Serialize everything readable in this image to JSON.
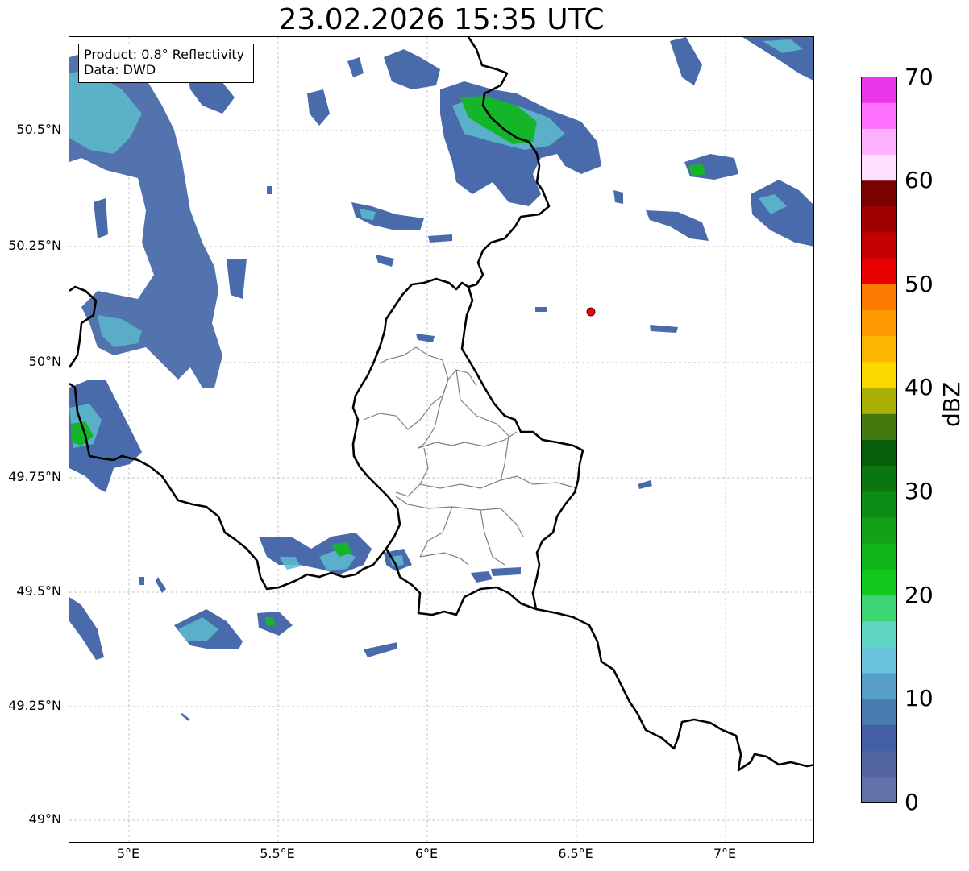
{
  "title": "23.02.2026 15:35 UTC",
  "info_box": {
    "product": "Product: 0.8° Reflectivity",
    "data": "Data: DWD"
  },
  "axes": {
    "lat_labels": [
      "50.5°N",
      "50.25°N",
      "50°N",
      "49.75°N",
      "49.5°N",
      "49.25°N",
      "49°N"
    ],
    "lon_labels": [
      "5°E",
      "5.5°E",
      "6°E",
      "6.5°E",
      "7°E"
    ]
  },
  "colorbar": {
    "label": "dBZ",
    "ticks": [
      "0",
      "10",
      "20",
      "30",
      "40",
      "50",
      "60",
      "70"
    ],
    "colors": [
      "#6272a8",
      "#5466a0",
      "#445fa5",
      "#4a7ab2",
      "#56a0c8",
      "#68c4dc",
      "#5fd4c0",
      "#3ed675",
      "#11c91e",
      "#11b51a",
      "#11a217",
      "#0c8c14",
      "#0b7610",
      "#075f0c",
      "#447a0d",
      "#aaaf04",
      "#fcd800",
      "#fcb600",
      "#fc9800",
      "#fc7b00",
      "#e60000",
      "#c50000",
      "#a00000",
      "#7d0000",
      "#ffe0ff",
      "#ffb1ff",
      "#ff70ff",
      "#ea36ea"
    ]
  },
  "marker": {
    "name": "radar-site",
    "color": "#ff0000"
  },
  "colors": {
    "echo_low": "#4a6bab",
    "echo_mid": "#5cbccc",
    "echo_high": "#15b52a"
  }
}
